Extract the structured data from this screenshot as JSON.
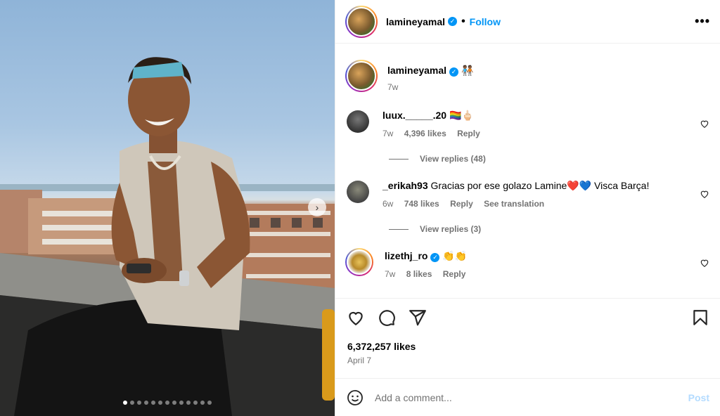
{
  "media": {
    "slide_count": 13,
    "active_slide": 1,
    "next_icon": "chevron-right-icon"
  },
  "header": {
    "username": "lamineyamal",
    "separator": "•",
    "follow_label": "Follow",
    "more_icon": "more-horizontal-icon"
  },
  "caption": {
    "username": "lamineyamal",
    "text": "🧑🏾‍🤝‍🧑🏾",
    "time": "7w"
  },
  "comments": [
    {
      "username": "luux._____.20",
      "text": "🏳️‍🌈🖕🏻",
      "time": "7w",
      "likes": "4,396 likes",
      "reply": "Reply",
      "translation": "",
      "replies": "View replies (48)",
      "verified": false
    },
    {
      "username": "_erikah93",
      "text": "Gracias por ese golazo Lamine❤️💙 Visca Barça!",
      "time": "6w",
      "likes": "748 likes",
      "reply": "Reply",
      "translation": "See translation",
      "replies": "View replies (3)",
      "verified": false
    },
    {
      "username": "lizethj_ro",
      "text": "👏👏",
      "time": "7w",
      "likes": "8 likes",
      "reply": "Reply",
      "translation": "",
      "replies": "",
      "verified": true
    }
  ],
  "stats": {
    "likes": "6,372,257 likes",
    "date": "April 7"
  },
  "composer": {
    "placeholder": "Add a comment...",
    "post_label": "Post"
  },
  "colors": {
    "accent": "#0095f6",
    "post_disabled": "#b3dbff",
    "muted": "#737373"
  }
}
